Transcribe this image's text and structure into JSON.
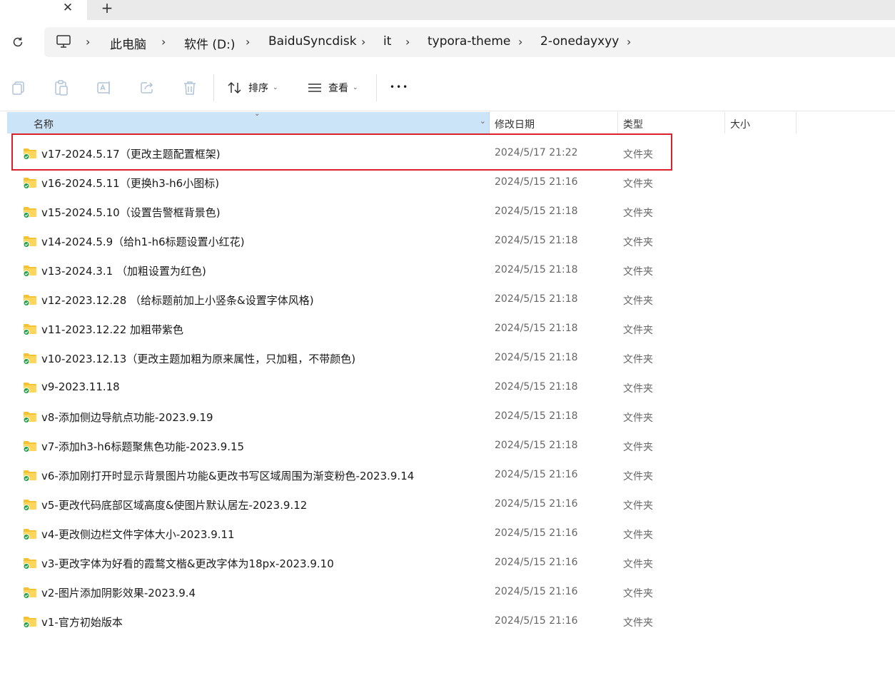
{
  "tab": {
    "close_glyph": "✕",
    "new_glyph": "+"
  },
  "breadcrumb": [
    "此电脑",
    "软件 (D:)",
    "BaiduSyncdisk",
    "it",
    "typora-theme",
    "2-onedayxyy"
  ],
  "toolbar": {
    "sort_label": "排序",
    "view_label": "查看",
    "more_label": "•••"
  },
  "columns": {
    "name": "名称",
    "modified": "修改日期",
    "type": "类型",
    "size": "大小"
  },
  "files": [
    {
      "name": "v17-2024.5.17（更改主题配置框架)",
      "date": "2024/5/17 21:22",
      "type": "文件夹"
    },
    {
      "name": "v16-2024.5.11（更换h3-h6小图标)",
      "date": "2024/5/15 21:16",
      "type": "文件夹"
    },
    {
      "name": "v15-2024.5.10（设置告警框背景色)",
      "date": "2024/5/15 21:18",
      "type": "文件夹"
    },
    {
      "name": "v14-2024.5.9（给h1-h6标题设置小红花)",
      "date": "2024/5/15 21:18",
      "type": "文件夹"
    },
    {
      "name": "v13-2024.3.1 （加粗设置为红色)",
      "date": "2024/5/15 21:18",
      "type": "文件夹"
    },
    {
      "name": "v12-2023.12.28 （给标题前加上小竖条&设置字体风格)",
      "date": "2024/5/15 21:18",
      "type": "文件夹"
    },
    {
      "name": "v11-2023.12.22 加粗带紫色",
      "date": "2024/5/15 21:18",
      "type": "文件夹"
    },
    {
      "name": "v10-2023.12.13（更改主题加粗为原来属性，只加粗，不带颜色)",
      "date": "2024/5/15 21:18",
      "type": "文件夹"
    },
    {
      "name": "v9-2023.11.18",
      "date": "2024/5/15 21:18",
      "type": "文件夹"
    },
    {
      "name": "v8-添加侧边导航点功能-2023.9.19",
      "date": "2024/5/15 21:18",
      "type": "文件夹"
    },
    {
      "name": "v7-添加h3-h6标题聚焦色功能-2023.9.15",
      "date": "2024/5/15 21:18",
      "type": "文件夹"
    },
    {
      "name": "v6-添加刚打开时显示背景图片功能&更改书写区域周围为渐变粉色-2023.9.14",
      "date": "2024/5/15 21:16",
      "type": "文件夹"
    },
    {
      "name": "v5-更改代码底部区域高度&使图片默认居左-2023.9.12",
      "date": "2024/5/15 21:16",
      "type": "文件夹"
    },
    {
      "name": "v4-更改侧边栏文件字体大小-2023.9.11",
      "date": "2024/5/15 21:16",
      "type": "文件夹"
    },
    {
      "name": "v3-更改字体为好看的霞鹜文楷&更改字体为18px-2023.9.10",
      "date": "2024/5/15 21:16",
      "type": "文件夹"
    },
    {
      "name": "v2-图片添加阴影效果-2023.9.4",
      "date": "2024/5/15 21:16",
      "type": "文件夹"
    },
    {
      "name": "v1-官方初始版本",
      "date": "2024/5/15 21:16",
      "type": "文件夹"
    }
  ],
  "colors": {
    "header_selected": "#cce4f7",
    "highlight_box": "#d9222a",
    "folder": "#f4c232",
    "sync_badge": "#22a04b"
  }
}
